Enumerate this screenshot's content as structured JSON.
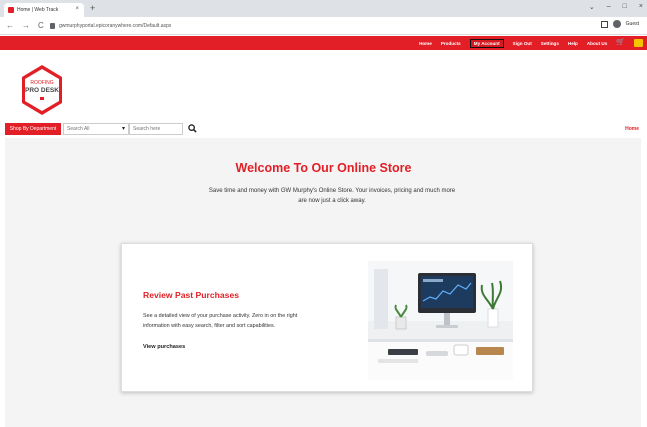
{
  "browser": {
    "tab_title": "Home | Web Track",
    "tab_close": "×",
    "new_tab": "+",
    "url": "gwmurphyportal.epicoranywhere.com/Default.aspx",
    "back": "←",
    "forward": "→",
    "reload": "C",
    "profile_label": "Guest",
    "window_controls": [
      "⌄",
      "–",
      "□",
      "×"
    ]
  },
  "nav": {
    "links": [
      "Home",
      "Products",
      "My Account",
      "Sign Out",
      "Settings",
      "Help",
      "About Us"
    ],
    "active": "My Account",
    "cart_icon": "shopping-cart-icon"
  },
  "logo": {
    "line1": "ROOFING",
    "line2": "PRO DESK"
  },
  "search": {
    "shop_by_department": "Shop By Department",
    "category_value": "Search All",
    "placeholder": "Search here"
  },
  "breadcrumb": {
    "home": "Home"
  },
  "hero": {
    "title": "Welcome To Our Online Store",
    "intro": "Save time and money with GW Murphy's Online Store. Your invoices, pricing and much more are now just a click away."
  },
  "card": {
    "title": "Review Past Purchases",
    "text": "See a detailed view of your purchase activity. Zero in on the right information with easy search, filter and sort capabilities.",
    "link": "View purchases"
  },
  "colors": {
    "brand_red": "#e21f26",
    "page_bg": "#f4f4f4"
  }
}
